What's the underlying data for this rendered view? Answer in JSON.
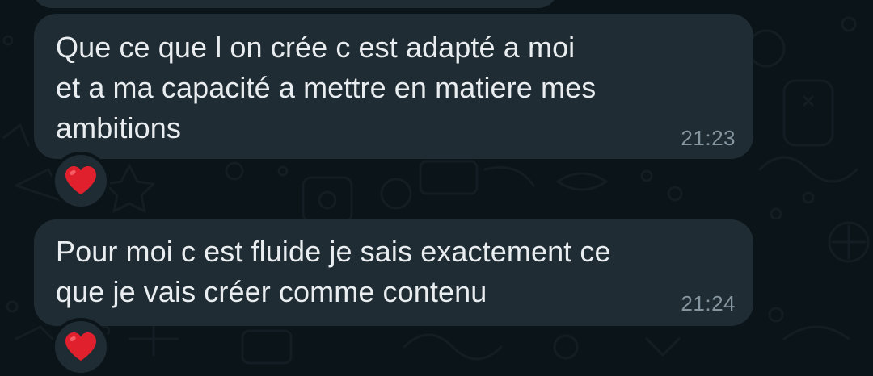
{
  "messages": [
    {
      "text": "Que ce que l on crée c est adapté a moi\net a ma capacité a mettre en matiere mes\nambitions",
      "time": "21:23",
      "reaction": "heart-icon"
    },
    {
      "text": "Pour moi c est fluide je sais exactement ce\nque je vais créer comme contenu",
      "time": "21:24",
      "reaction": "heart-icon"
    }
  ],
  "colors": {
    "background": "#0b1418",
    "bubble": "#1f2c34",
    "text": "#e9edef",
    "timestamp": "#8696a0",
    "heart": "#e0202d"
  }
}
